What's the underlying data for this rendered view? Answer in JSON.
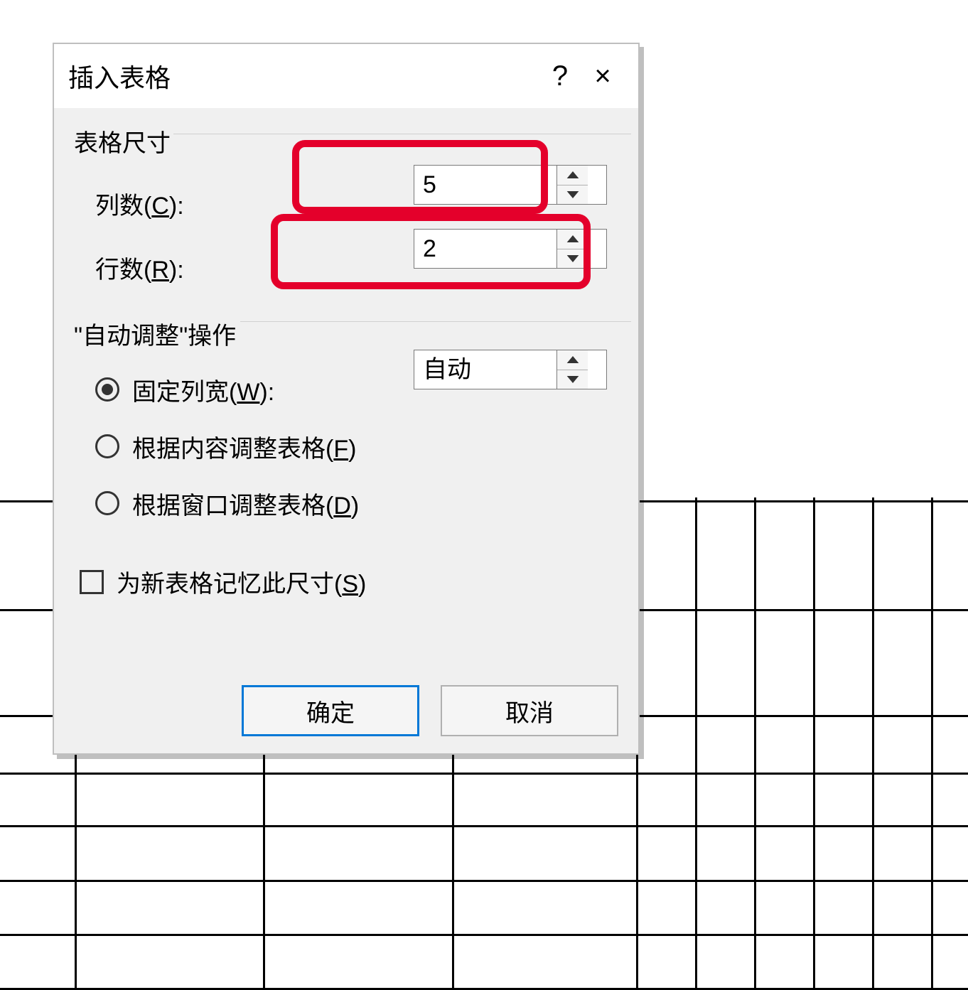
{
  "dialog": {
    "title": "插入表格",
    "help_icon": "?",
    "close_icon": "×"
  },
  "sections": {
    "size": {
      "label": "表格尺寸",
      "columns": {
        "label_pre": "列数(",
        "hotkey": "C",
        "label_post": "):",
        "value": "5"
      },
      "rows": {
        "label_pre": "行数(",
        "hotkey": "R",
        "label_post": "):",
        "value": "2"
      }
    },
    "autofit": {
      "label": "\"自动调整\"操作",
      "options": {
        "fixed": {
          "label_pre": "固定列宽(",
          "hotkey": "W",
          "label_post": "):",
          "value": "自动",
          "checked": true
        },
        "by_content": {
          "label_pre": "根据内容调整表格(",
          "hotkey": "F",
          "label_post": ")",
          "checked": false
        },
        "by_window": {
          "label_pre": "根据窗口调整表格(",
          "hotkey": "D",
          "label_post": ")",
          "checked": false
        }
      }
    },
    "remember": {
      "label_pre": "为新表格记忆此尺寸(",
      "hotkey": "S",
      "label_post": ")",
      "checked": false
    }
  },
  "buttons": {
    "ok": "确定",
    "cancel": "取消"
  }
}
